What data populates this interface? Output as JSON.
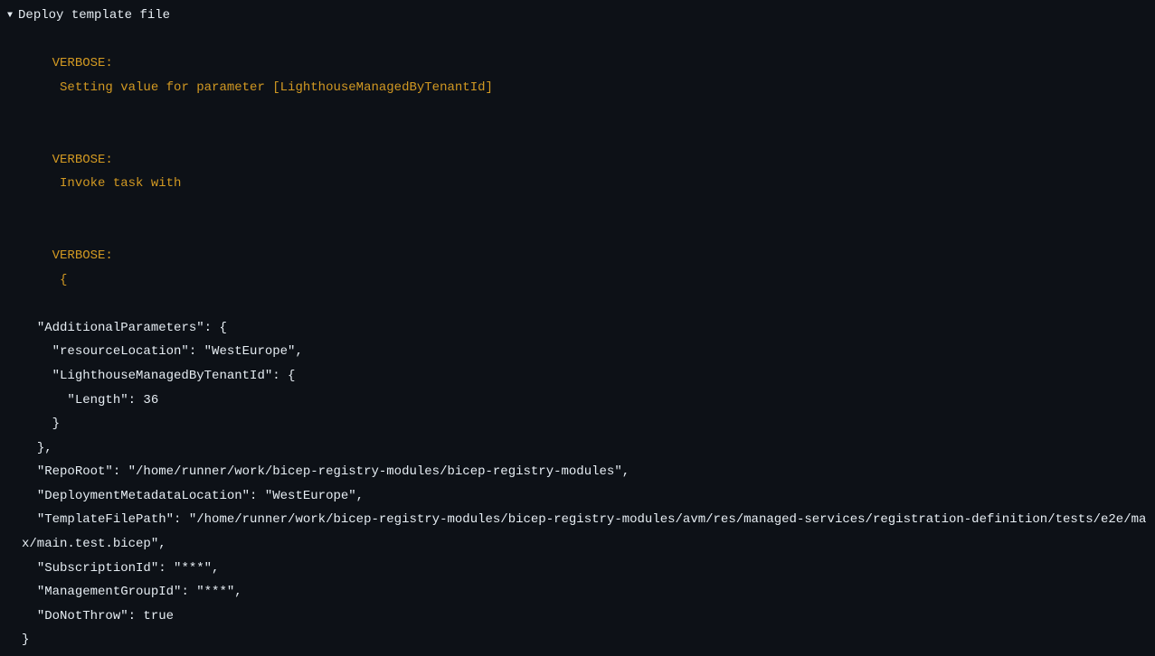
{
  "step": {
    "title": "Deploy template file"
  },
  "verbose": {
    "label": "VERBOSE:",
    "line1": "Setting value for parameter [LighthouseManagedByTenantId]",
    "line2": "Invoke task with",
    "line3": "{"
  },
  "json": {
    "l1": "  \"AdditionalParameters\": {",
    "l2": "    \"resourceLocation\": \"WestEurope\",",
    "l3": "    \"LighthouseManagedByTenantId\": {",
    "l4": "      \"Length\": 36",
    "l5": "    }",
    "l6": "  },",
    "l7": "  \"RepoRoot\": \"/home/runner/work/bicep-registry-modules/bicep-registry-modules\",",
    "l8": "  \"DeploymentMetadataLocation\": \"WestEurope\",",
    "l9": "  \"TemplateFilePath\": \"/home/runner/work/bicep-registry-modules/bicep-registry-modules/avm/res/managed-services/registration-definition/tests/e2e/max/main.test.bicep\",",
    "l10": "  \"SubscriptionId\": \"***\",",
    "l11": "  \"ManagementGroupId\": \"***\",",
    "l12": "  \"DoNotThrow\": true",
    "l13": "}"
  }
}
